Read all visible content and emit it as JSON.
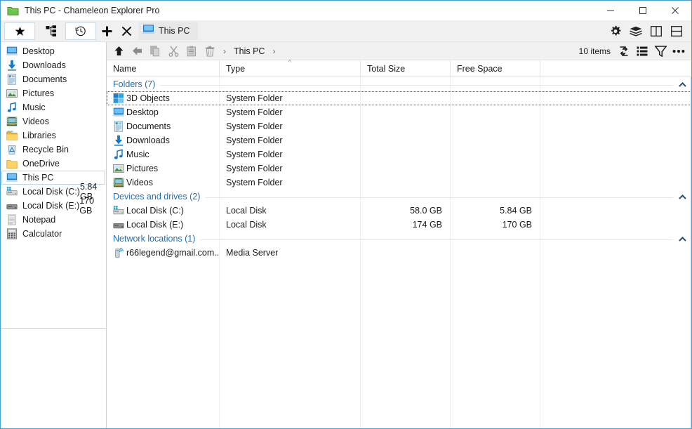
{
  "window": {
    "title": "This PC - Chameleon Explorer Pro",
    "icon": "folder-icon",
    "controls": {
      "minimize": "—",
      "maximize": "□",
      "close": "✕"
    }
  },
  "toolbar": {
    "favorites_label": "★",
    "tree_label": "tree-icon",
    "history_label": "history-icon",
    "new_tab_label": "✚",
    "close_tab_label": "✖",
    "right_icons": [
      {
        "name": "settings-icon",
        "glyph": "⚙"
      },
      {
        "name": "layers-icon",
        "glyph": "≡"
      },
      {
        "name": "split-vertical-icon",
        "glyph": "◫"
      },
      {
        "name": "split-horizontal-icon",
        "glyph": "⊟"
      }
    ]
  },
  "tabs": [
    {
      "label": "This PC",
      "icon": "computer-icon",
      "active": true
    }
  ],
  "navbar": {
    "buttons": [
      {
        "name": "up-button",
        "glyph": "⬆"
      },
      {
        "name": "back-button",
        "glyph": "⬅"
      },
      {
        "name": "copy-button",
        "glyph": "copy-icon"
      },
      {
        "name": "cut-button",
        "glyph": "cut-icon"
      },
      {
        "name": "paste-button",
        "glyph": "paste-icon"
      },
      {
        "name": "delete-button",
        "glyph": "trash-icon"
      }
    ],
    "breadcrumb_lead": "›",
    "breadcrumb": "This PC",
    "breadcrumb_trail": "›",
    "items_count": "10 items",
    "right_icons": [
      {
        "name": "refresh-icon",
        "glyph": "↻"
      },
      {
        "name": "list-view-icon",
        "glyph": "☰"
      },
      {
        "name": "filter-icon",
        "glyph": "▽"
      },
      {
        "name": "more-options-icon",
        "glyph": "•••"
      }
    ]
  },
  "sidebar": {
    "items": [
      {
        "label": "Desktop",
        "icon": "desktop-icon",
        "extra": "",
        "selected": false
      },
      {
        "label": "Downloads",
        "icon": "downloads-icon",
        "extra": "",
        "selected": false
      },
      {
        "label": "Documents",
        "icon": "documents-icon",
        "extra": "",
        "selected": false
      },
      {
        "label": "Pictures",
        "icon": "pictures-icon",
        "extra": "",
        "selected": false
      },
      {
        "label": "Music",
        "icon": "music-icon",
        "extra": "",
        "selected": false
      },
      {
        "label": "Videos",
        "icon": "videos-icon",
        "extra": "",
        "selected": false
      },
      {
        "label": "Libraries",
        "icon": "libraries-icon",
        "extra": "",
        "selected": false
      },
      {
        "label": "Recycle Bin",
        "icon": "recycle-bin-icon",
        "extra": "",
        "selected": false
      },
      {
        "label": "OneDrive",
        "icon": "onedrive-icon",
        "extra": "",
        "selected": false
      },
      {
        "label": "This PC",
        "icon": "computer-icon",
        "extra": "",
        "selected": true
      },
      {
        "label": "Local Disk (C:)",
        "icon": "drive-c-icon",
        "extra": "5.84 GB",
        "selected": false
      },
      {
        "label": "Local Disk (E:)",
        "icon": "drive-e-icon",
        "extra": "170 GB",
        "selected": false
      },
      {
        "label": "Notepad",
        "icon": "notepad-icon",
        "extra": "",
        "selected": false
      },
      {
        "label": "Calculator",
        "icon": "calculator-icon",
        "extra": "",
        "selected": false
      }
    ]
  },
  "columns": {
    "name": "Name",
    "type": "Type",
    "total_size": "Total Size",
    "free_space": "Free Space",
    "sorted_by": "Type",
    "sort_direction": "ascending"
  },
  "groups": [
    {
      "title": "Folders (7)",
      "rows": [
        {
          "name": "3D Objects",
          "icon": "3d-objects-icon",
          "type": "System Folder",
          "total_size": "",
          "free_space": "",
          "focused": true
        },
        {
          "name": "Desktop",
          "icon": "desktop-icon",
          "type": "System Folder",
          "total_size": "",
          "free_space": "",
          "focused": false
        },
        {
          "name": "Documents",
          "icon": "documents-icon",
          "type": "System Folder",
          "total_size": "",
          "free_space": "",
          "focused": false
        },
        {
          "name": "Downloads",
          "icon": "downloads-icon",
          "type": "System Folder",
          "total_size": "",
          "free_space": "",
          "focused": false
        },
        {
          "name": "Music",
          "icon": "music-icon",
          "type": "System Folder",
          "total_size": "",
          "free_space": "",
          "focused": false
        },
        {
          "name": "Pictures",
          "icon": "pictures-icon",
          "type": "System Folder",
          "total_size": "",
          "free_space": "",
          "focused": false
        },
        {
          "name": "Videos",
          "icon": "videos-icon",
          "type": "System Folder",
          "total_size": "",
          "free_space": "",
          "focused": false
        }
      ]
    },
    {
      "title": "Devices and drives (2)",
      "rows": [
        {
          "name": "Local Disk (C:)",
          "icon": "drive-c-icon",
          "type": "Local Disk",
          "total_size": "58.0 GB",
          "free_space": "5.84 GB",
          "focused": false
        },
        {
          "name": "Local Disk (E:)",
          "icon": "drive-e-icon",
          "type": "Local Disk",
          "total_size": "174 GB",
          "free_space": "170 GB",
          "focused": false
        }
      ]
    },
    {
      "title": "Network locations (1)",
      "rows": [
        {
          "name": "r66legend@gmail.com...",
          "icon": "network-location-icon",
          "type": "Media Server",
          "total_size": "",
          "free_space": "",
          "focused": false
        }
      ]
    }
  ],
  "colors": {
    "accent": "#4a9fd4",
    "group_title": "#1f6fb5",
    "toolbar_bg": "#f0f0f0",
    "text": "#1a1a1a"
  }
}
